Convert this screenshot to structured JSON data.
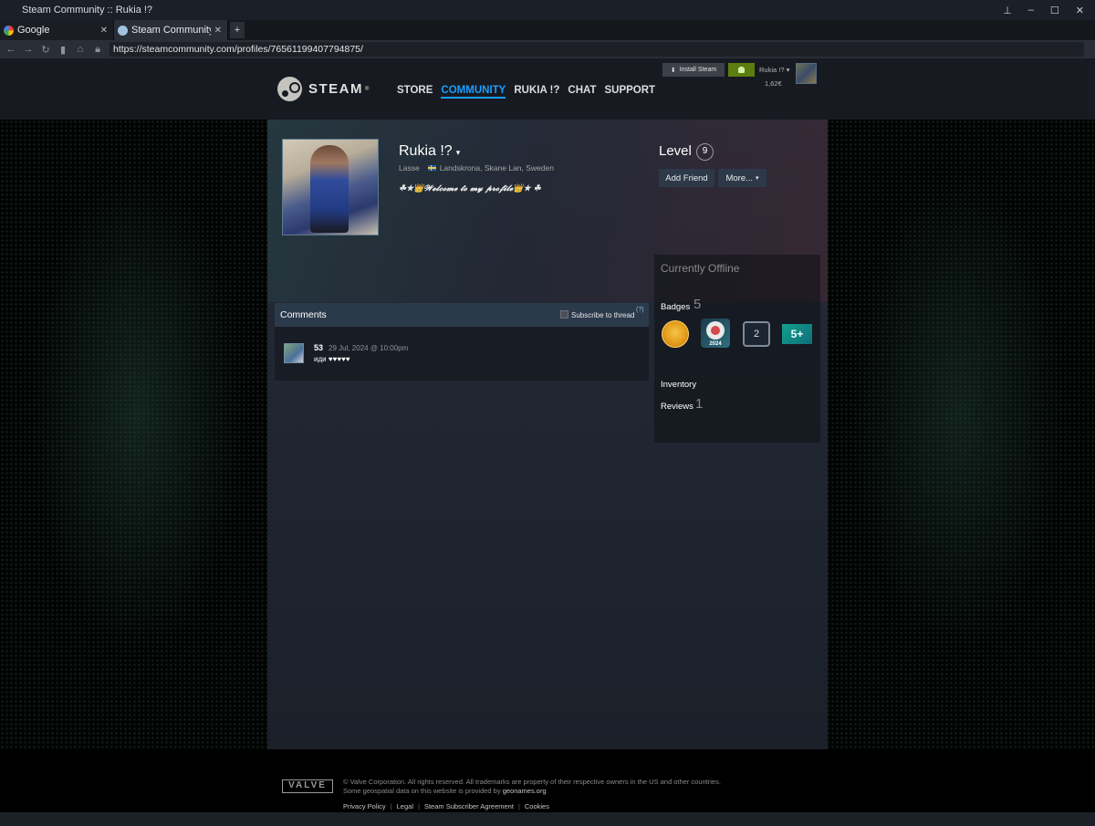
{
  "window": {
    "title": "Steam Community :: Rukia !?"
  },
  "tabs": [
    {
      "label": "Google",
      "active": false,
      "icon": "google-icon"
    },
    {
      "label": "Steam Community :: ...",
      "active": true,
      "icon": "steam-icon"
    }
  ],
  "address": {
    "url": "https://steamcommunity.com/profiles/76561199407794875/"
  },
  "header": {
    "logo_text": "STEAM",
    "logo_reg": "®",
    "nav": [
      "STORE",
      "COMMUNITY",
      "RUKIA !?",
      "CHAT",
      "SUPPORT"
    ],
    "active_nav": "COMMUNITY",
    "install_label": "Install Steam",
    "account_name": "Rukia !? ▾",
    "wallet_balance": "1,62€",
    "notify_color": "#5c7e10",
    "accent_color": "#1a9fff"
  },
  "profile": {
    "persona_name": "Rukia !?",
    "real_name": "Lasse",
    "location": "Landskrona, Skane Lan, Sweden",
    "summary": "☘★👑𝓦𝓮𝓵𝓬𝓸𝓶𝓮 𝓽𝓸 𝓶𝔂 𝓹𝓻𝓸𝓯𝓲𝓵𝓮👑★ ☘",
    "level_label": "Level",
    "level": "9",
    "add_friend": "Add Friend",
    "more": "More..."
  },
  "sidebar": {
    "status": "Currently Offline",
    "badges_label": "Badges",
    "badges_count": "5",
    "badges": [
      {
        "name": "gold-coin-badge",
        "text": ""
      },
      {
        "name": "steam-2024-badge",
        "text": "2024"
      },
      {
        "name": "years-badge",
        "text": "2"
      },
      {
        "name": "game-collector-badge",
        "text": "5+"
      }
    ],
    "inventory_label": "Inventory",
    "reviews_label": "Reviews",
    "reviews_count": "1"
  },
  "comments": {
    "title": "Comments",
    "subscribe_label": "Subscribe to thread",
    "help": "(?)",
    "items": [
      {
        "author": "53",
        "timestamp": "29 Jul, 2024 @ 10:00pm",
        "text": "иди ♥♥♥♥♥"
      }
    ]
  },
  "footer": {
    "valve": "VALVE",
    "copyright_line1": "© Valve Corporation. All rights reserved. All trademarks are property of their respective owners in the US and other countries.",
    "copyright_line2_prefix": "Some geospatial data on this website is provided by ",
    "geonames": "geonames.org",
    "links": [
      "Privacy Policy",
      "Legal",
      "Steam Subscriber Agreement",
      "Cookies"
    ]
  }
}
